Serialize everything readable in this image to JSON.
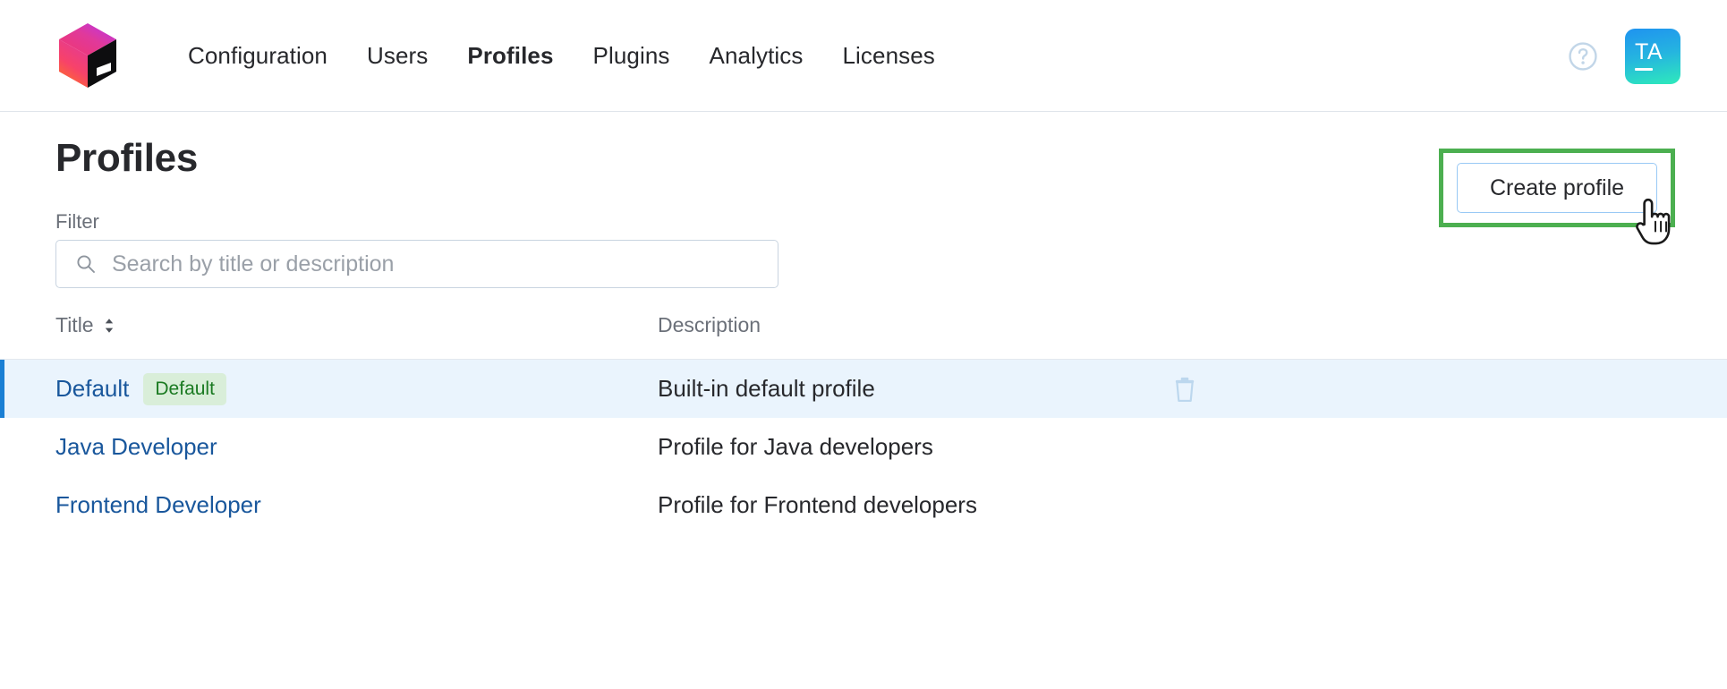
{
  "header": {
    "logo_name": "jetbrains-cube-logo",
    "nav_items": [
      {
        "label": "Configuration",
        "active": false
      },
      {
        "label": "Users",
        "active": false
      },
      {
        "label": "Profiles",
        "active": true
      },
      {
        "label": "Plugins",
        "active": false
      },
      {
        "label": "Analytics",
        "active": false
      },
      {
        "label": "Licenses",
        "active": false
      }
    ],
    "help_icon": "help-circle-icon",
    "avatar": {
      "initials": "TA",
      "gradient_from": "#1f93f0",
      "gradient_to": "#2eeabb"
    }
  },
  "page": {
    "title": "Profiles",
    "create_button": {
      "label": "Create profile",
      "border_color": "#99c9f5"
    },
    "annotation": {
      "color": "#4caf50"
    }
  },
  "filter": {
    "label": "Filter",
    "placeholder": "Search by title or description",
    "value": "",
    "icon": "search-icon"
  },
  "table": {
    "columns": [
      {
        "label": "Title",
        "sortable": true,
        "sort_icon": "sort-chevrons-icon"
      },
      {
        "label": "Description",
        "sortable": false
      }
    ],
    "rows": [
      {
        "title": "Default",
        "badge": "Default",
        "description": "Built-in default profile",
        "selected": true,
        "delete_icon": "trash-icon"
      },
      {
        "title": "Java Developer",
        "badge": "",
        "description": "Profile for Java developers",
        "selected": false,
        "delete_icon": ""
      },
      {
        "title": "Frontend Developer",
        "badge": "",
        "description": "Profile for Frontend developers",
        "selected": false,
        "delete_icon": ""
      }
    ]
  },
  "cursor": {
    "type": "pointing-hand-cursor"
  },
  "colors": {
    "link": "#19579c",
    "selected_row_bg": "#eaf4fd",
    "selected_row_accent": "#1a7fd4",
    "badge_bg": "#d9eed9",
    "badge_text": "#1a7a21",
    "text_primary": "#27282c",
    "text_muted": "#6b7079"
  }
}
